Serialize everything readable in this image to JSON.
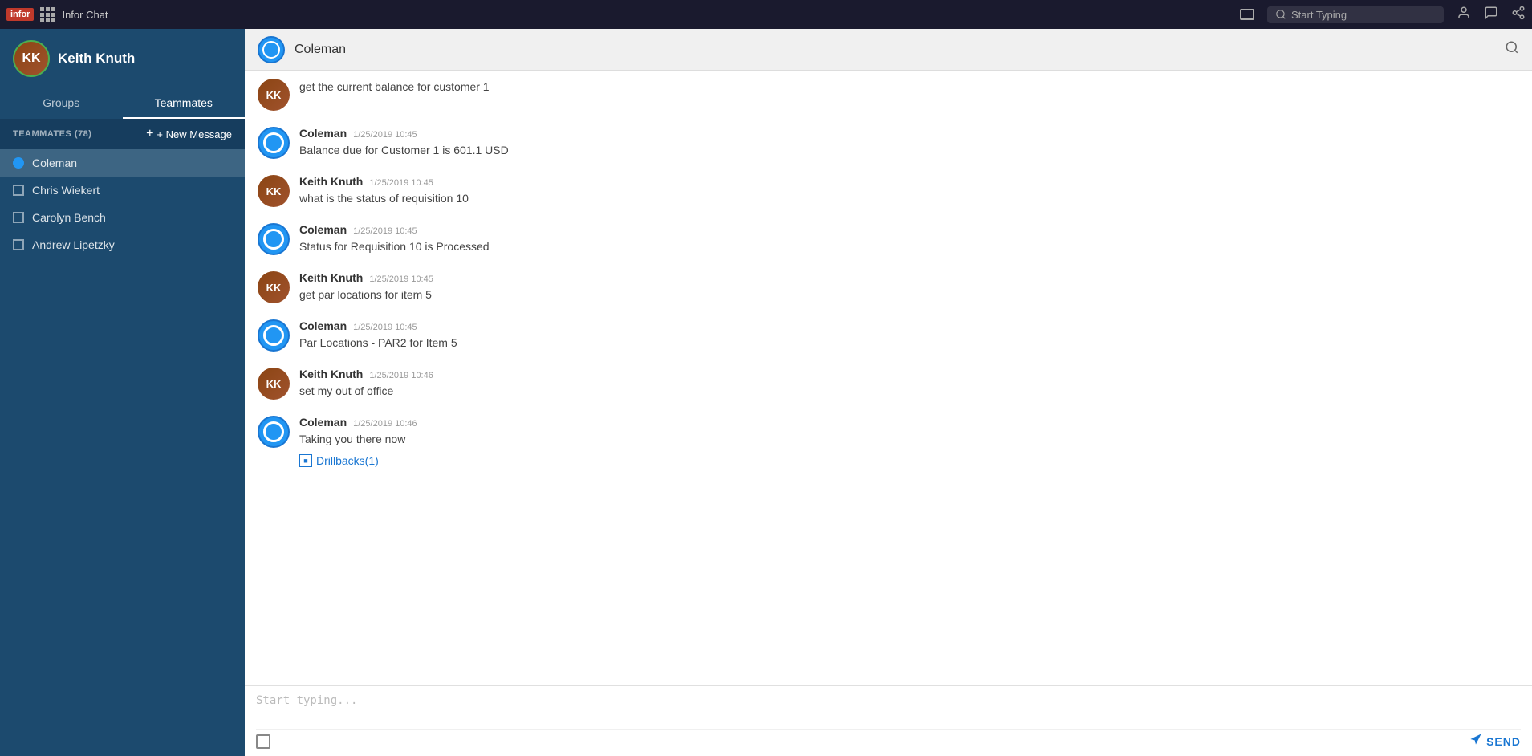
{
  "app": {
    "logo_text": "infor",
    "title": "Infor Chat",
    "search_placeholder": "Start Typing"
  },
  "sidebar": {
    "user": {
      "name": "Keith Knuth",
      "online": true
    },
    "tabs": [
      {
        "label": "Groups",
        "active": false
      },
      {
        "label": "Teammates",
        "active": true
      }
    ],
    "teammates_label": "TEAMMATES (78)",
    "new_message_label": "+ New Message",
    "contacts": [
      {
        "name": "Coleman",
        "active": true,
        "type": "dot"
      },
      {
        "name": "Chris Wiekert",
        "active": false,
        "type": "square"
      },
      {
        "name": "Carolyn Bench",
        "active": false,
        "type": "square"
      },
      {
        "name": "Andrew Lipetzky",
        "active": false,
        "type": "square"
      }
    ]
  },
  "chat": {
    "header": {
      "name": "Coleman"
    },
    "messages": [
      {
        "sender": "",
        "time": "",
        "text": "get the current balance for customer 1",
        "type": "user_partial",
        "avatar": "user"
      },
      {
        "sender": "Coleman",
        "time": "1/25/2019 10:45",
        "text": "Balance due for Customer 1 is 601.1 USD",
        "type": "bot",
        "avatar": "bot"
      },
      {
        "sender": "Keith Knuth",
        "time": "1/25/2019 10:45",
        "text": "what is the status of requisition 10",
        "type": "user",
        "avatar": "user"
      },
      {
        "sender": "Coleman",
        "time": "1/25/2019 10:45",
        "text": "Status for Requisition 10 is Processed",
        "type": "bot",
        "avatar": "bot"
      },
      {
        "sender": "Keith Knuth",
        "time": "1/25/2019 10:45",
        "text": "get par locations for item 5",
        "type": "user",
        "avatar": "user"
      },
      {
        "sender": "Coleman",
        "time": "1/25/2019 10:45",
        "text": "Par Locations - PAR2 for Item 5",
        "type": "bot",
        "avatar": "bot"
      },
      {
        "sender": "Keith Knuth",
        "time": "1/25/2019 10:46",
        "text": "set my out of office",
        "type": "user",
        "avatar": "user"
      },
      {
        "sender": "Coleman",
        "time": "1/25/2019 10:46",
        "text": "Taking you there now",
        "type": "bot",
        "avatar": "bot",
        "drillback": "Drillbacks(1)"
      }
    ],
    "input_placeholder": "Start typing...",
    "send_label": "SEND"
  }
}
